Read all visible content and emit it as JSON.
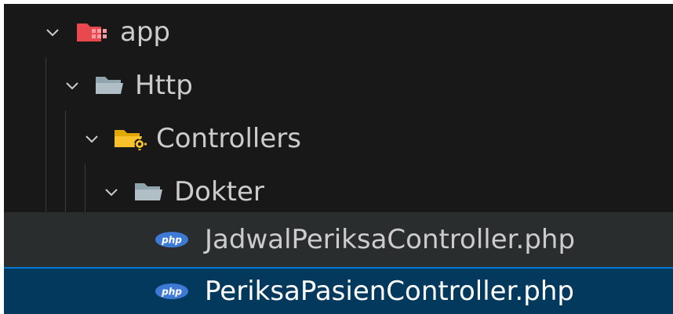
{
  "explorer": {
    "items": [
      {
        "label": "app",
        "type": "folder",
        "icon": "folder-app-icon",
        "expanded": true
      },
      {
        "label": "Http",
        "type": "folder",
        "icon": "folder-icon",
        "expanded": true
      },
      {
        "label": "Controllers",
        "type": "folder",
        "icon": "folder-controllers-icon",
        "expanded": true
      },
      {
        "label": "Dokter",
        "type": "folder",
        "icon": "folder-icon",
        "expanded": true
      },
      {
        "label": "JadwalPeriksaController.php",
        "type": "file",
        "icon": "php-file-icon",
        "state": "hover"
      },
      {
        "label": "PeriksaPasienController.php",
        "type": "file",
        "icon": "php-file-icon",
        "state": "selected"
      }
    ]
  },
  "colors": {
    "background": "#181818",
    "hover": "#2a2d2e",
    "selected": "#04395e",
    "focus_border": "#0078d4",
    "text": "#cccccc",
    "folder_app": "#e8494f",
    "folder_default": "#90a4ae",
    "folder_controllers": "#f9c22c",
    "php_badge": "#3d7ad6"
  }
}
